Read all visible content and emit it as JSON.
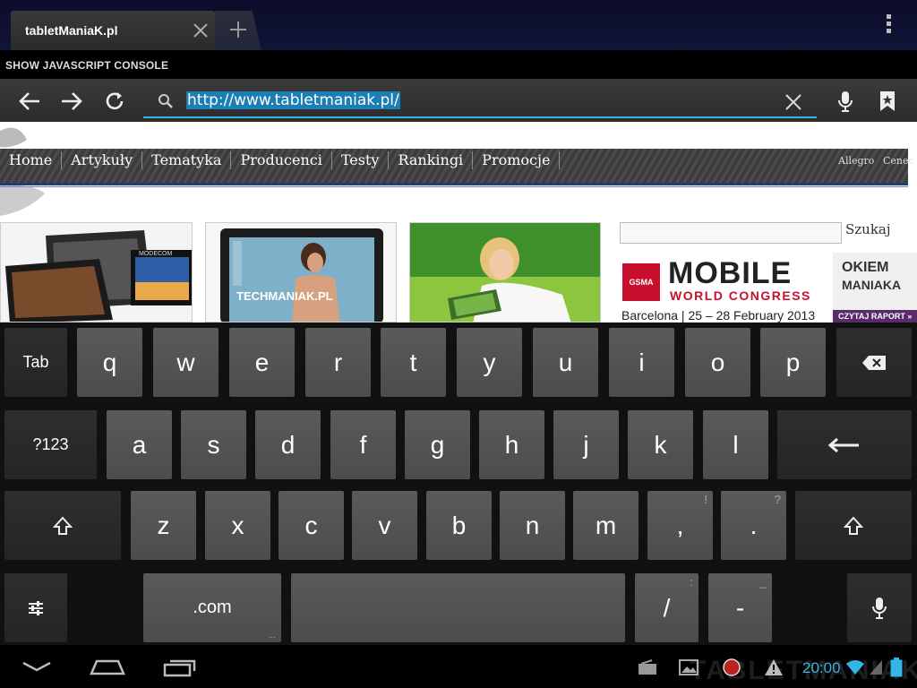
{
  "tabs": [
    {
      "title": "tabletManiaK.pl"
    }
  ],
  "console": {
    "label": "SHOW JAVASCRIPT CONSOLE"
  },
  "url": {
    "value": "http://www.tabletmaniak.pl/"
  },
  "site": {
    "nav": [
      "Home",
      "Artykuły",
      "Tematyka",
      "Producenci",
      "Testy",
      "Rankingi",
      "Promocje"
    ],
    "nav_right": [
      "Allegro",
      "Cenec"
    ],
    "search_label": "Szukaj",
    "thumb2_label": "TECHMANIAK.PL",
    "thumb1_label": "MODECOM",
    "banner": {
      "gsma": "GSMA",
      "title": "MOBILE",
      "subtitle": "WORLD CONGRESS",
      "city": "Barcelona | 25 – 28 February 2013"
    },
    "okiem": {
      "line1": "OKIEM",
      "line2": "MANIAKA",
      "button": "CZYTAJ RAPORT »"
    }
  },
  "keyboard": {
    "row1": [
      "Tab",
      "q",
      "w",
      "e",
      "r",
      "t",
      "y",
      "u",
      "i",
      "o",
      "p"
    ],
    "row2": [
      "?123",
      "a",
      "s",
      "d",
      "f",
      "g",
      "h",
      "j",
      "k",
      "l"
    ],
    "row3": [
      "z",
      "x",
      "c",
      "v",
      "b",
      "n",
      "m",
      ",",
      "."
    ],
    "row3_hints": [
      "!",
      "?"
    ],
    "row4": {
      "dotcom": ".com",
      "dotcom_hint": "...",
      "slash": "/",
      "slash_hint": ":",
      "dash": "-",
      "dash_hint": "_"
    }
  },
  "status": {
    "time": "20:00",
    "watermark": "TABLETMANIAK"
  },
  "colors": {
    "accent": "#33b5e5",
    "nav_accent": "#1f3c78",
    "mwc_red": "#c8102e"
  }
}
